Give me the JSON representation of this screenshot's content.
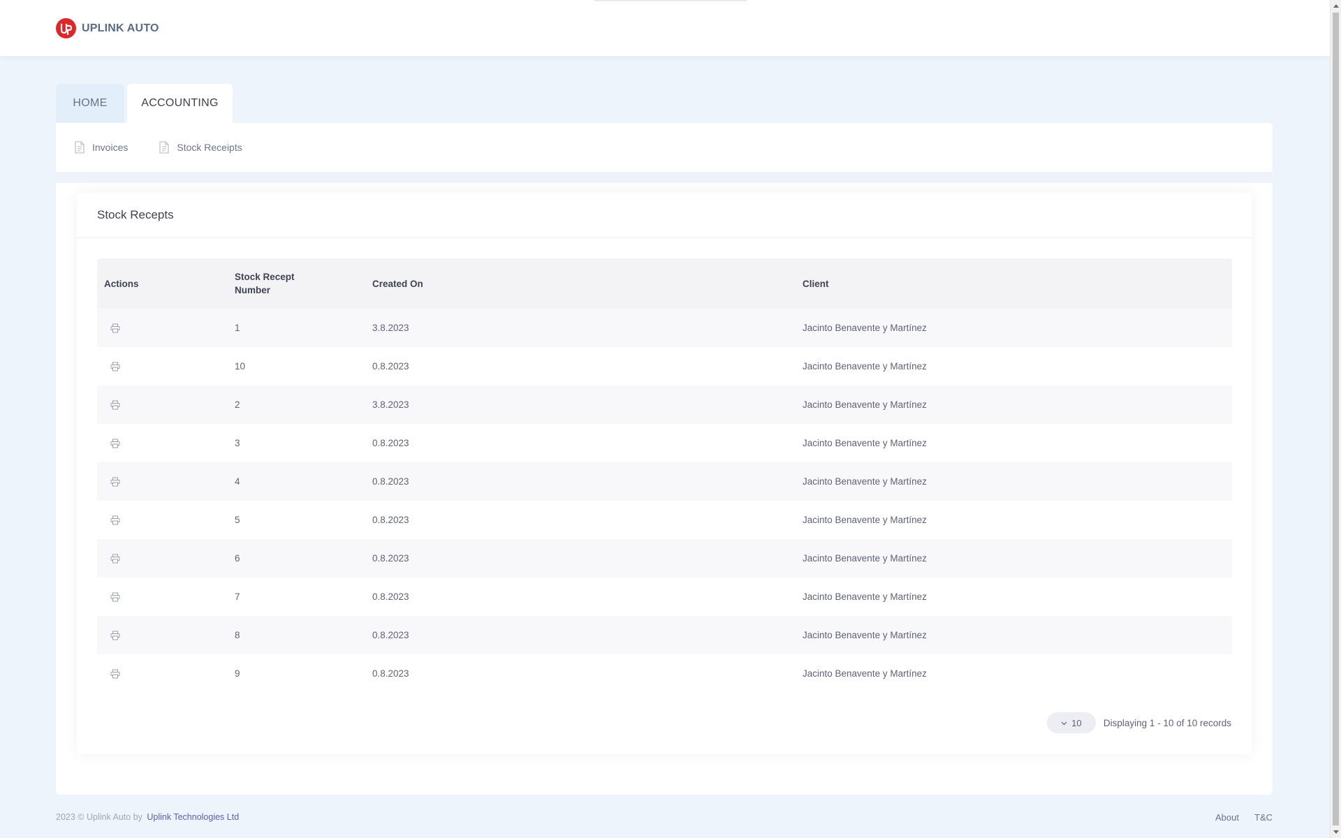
{
  "brand": {
    "name": "UPLINK AUTO"
  },
  "tabs": [
    {
      "label": "HOME"
    },
    {
      "label": "ACCOUNTING"
    }
  ],
  "subnav": [
    {
      "label": "Invoices",
      "icon": "document-icon"
    },
    {
      "label": "Stock Receipts",
      "icon": "document-icon"
    }
  ],
  "card": {
    "title": "Stock Recepts"
  },
  "table": {
    "headers": [
      "Actions",
      "Stock Recept Number",
      "Created On",
      "Client"
    ],
    "rows": [
      {
        "number": "1",
        "created": "3.8.2023",
        "client": "Jacinto Benavente y Martínez"
      },
      {
        "number": "10",
        "created": "0.8.2023",
        "client": "Jacinto Benavente y Martínez"
      },
      {
        "number": "2",
        "created": "3.8.2023",
        "client": "Jacinto Benavente y Martínez"
      },
      {
        "number": "3",
        "created": "0.8.2023",
        "client": "Jacinto Benavente y Martínez"
      },
      {
        "number": "4",
        "created": "0.8.2023",
        "client": "Jacinto Benavente y Martínez"
      },
      {
        "number": "5",
        "created": "0.8.2023",
        "client": "Jacinto Benavente y Martínez"
      },
      {
        "number": "6",
        "created": "0.8.2023",
        "client": "Jacinto Benavente y Martínez"
      },
      {
        "number": "7",
        "created": "0.8.2023",
        "client": "Jacinto Benavente y Martínez"
      },
      {
        "number": "8",
        "created": "0.8.2023",
        "client": "Jacinto Benavente y Martínez"
      },
      {
        "number": "9",
        "created": "0.8.2023",
        "client": "Jacinto Benavente y Martínez"
      }
    ]
  },
  "pager": {
    "page_size": "10",
    "summary": "Displaying 1 - 10 of 10 records"
  },
  "footer": {
    "copyright": "2023 © Uplink Auto by",
    "company": "Uplink Technologies Ltd",
    "links": [
      "About",
      "T&C"
    ]
  },
  "colors": {
    "brand_red": "#e0262b",
    "page_bg": "#eef4fb",
    "link": "#5b5fb5"
  }
}
